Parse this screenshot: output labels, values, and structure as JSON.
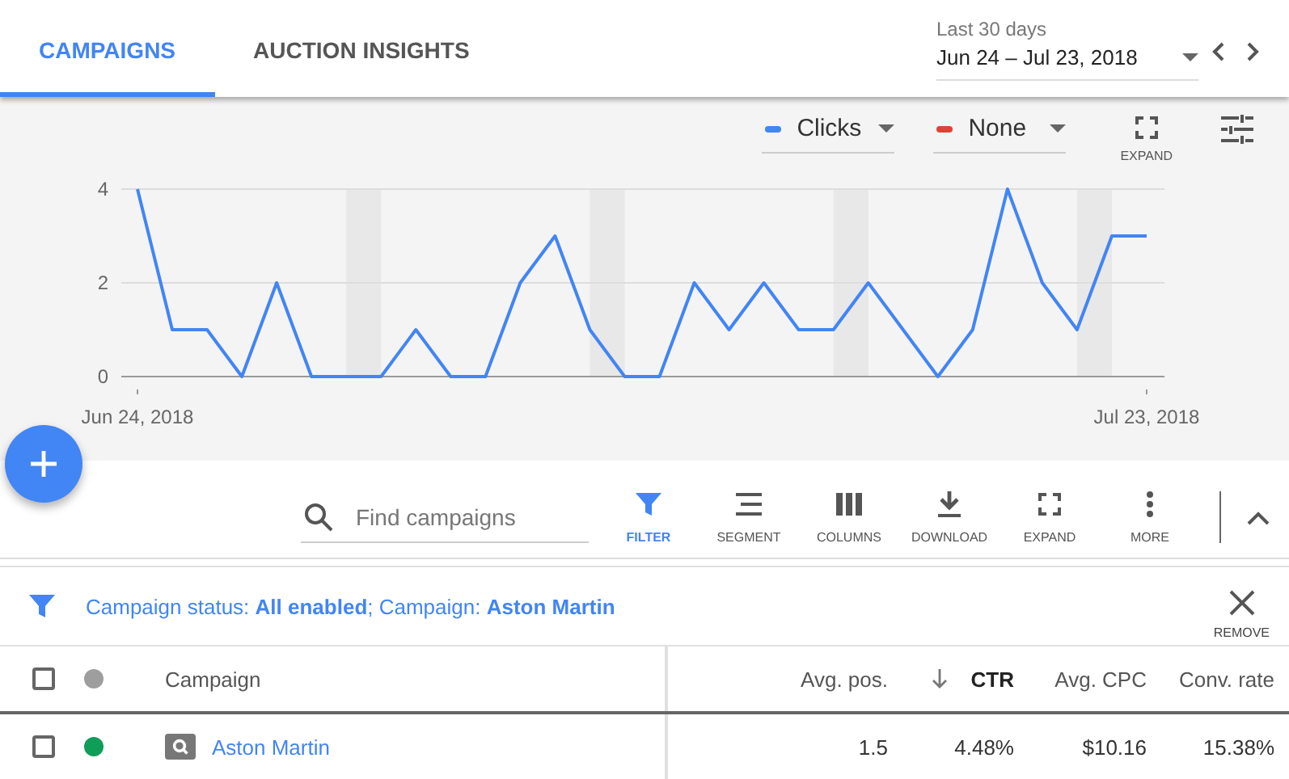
{
  "tabs": [
    {
      "label": "CAMPAIGNS",
      "selected": true
    },
    {
      "label": "AUCTION INSIGHTS",
      "selected": false
    }
  ],
  "date_range": {
    "label": "Last 30 days",
    "value": "Jun 24 – Jul 23, 2018"
  },
  "chart_controls": {
    "metrics": [
      {
        "label": "Clicks",
        "color": "#4285f4"
      },
      {
        "label": "None",
        "color": "#db4437"
      }
    ],
    "expand_label": "EXPAND"
  },
  "chart": {
    "chart_data": {
      "type": "line",
      "categories": [
        "Jun 24, 2018",
        null,
        null,
        null,
        null,
        null,
        null,
        null,
        null,
        null,
        null,
        null,
        null,
        null,
        null,
        null,
        null,
        null,
        null,
        null,
        null,
        null,
        null,
        null,
        null,
        null,
        null,
        null,
        null,
        "Jul 23, 2018"
      ],
      "series": [
        {
          "color": "#4285f4",
          "values": [
            4,
            1,
            1,
            0,
            2,
            0,
            0,
            0,
            1,
            0,
            0,
            2,
            3,
            1,
            0,
            0,
            2,
            1,
            2,
            1,
            1,
            2,
            1,
            0,
            1,
            4,
            2,
            1,
            3,
            3
          ]
        }
      ],
      "ylim": [
        0,
        4
      ],
      "yticks": [
        0,
        2,
        4
      ]
    }
  },
  "toolbar": {
    "search": {
      "placeholder": "Find campaigns"
    },
    "actions": [
      {
        "kind": "filter",
        "label": "FILTER",
        "active": true
      },
      {
        "kind": "segment",
        "label": "SEGMENT",
        "active": false
      },
      {
        "kind": "columns",
        "label": "COLUMNS",
        "active": false
      },
      {
        "kind": "download",
        "label": "DOWNLOAD",
        "active": false
      },
      {
        "kind": "expand",
        "label": "EXPAND",
        "active": false
      },
      {
        "kind": "more",
        "label": "MORE",
        "active": false
      }
    ]
  },
  "filter_bar": {
    "text": "Campaign status: **All enabled**; Campaign: **Aston Martin**",
    "remove_label": "REMOVE"
  },
  "table": {
    "all_checked": false,
    "columns": [
      {
        "label": "Campaign",
        "sorted": false
      },
      {
        "label": "Avg. pos.",
        "sorted": false
      },
      {
        "label": "CTR",
        "sorted": true
      },
      {
        "label": "Avg. CPC",
        "sorted": false
      },
      {
        "label": "Conv. rate",
        "sorted": false
      }
    ],
    "rows": [
      {
        "checked": false,
        "color": "#0f9d58",
        "cells": [
          "Aston Martin",
          "1.5",
          "4.48%",
          "$10.16",
          "15.38%"
        ]
      }
    ]
  }
}
